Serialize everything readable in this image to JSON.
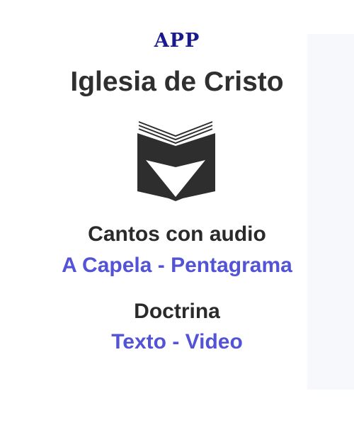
{
  "header": {
    "app_label": "APP",
    "title": "Iglesia de Cristo"
  },
  "logo": {
    "icon": "open-book-icon"
  },
  "sections": {
    "cantos": {
      "heading": "Cantos con audio",
      "subtitle": "A Capela - Pentagrama"
    },
    "doctrina": {
      "heading": "Doctrina",
      "subtitle": "Texto - Video"
    }
  },
  "colors": {
    "app_label": "#1a1a8c",
    "heading": "#2a2a2a",
    "accent": "#5353d8",
    "side_panel": "#f7f8fb",
    "logo": "#2e2e2e"
  }
}
